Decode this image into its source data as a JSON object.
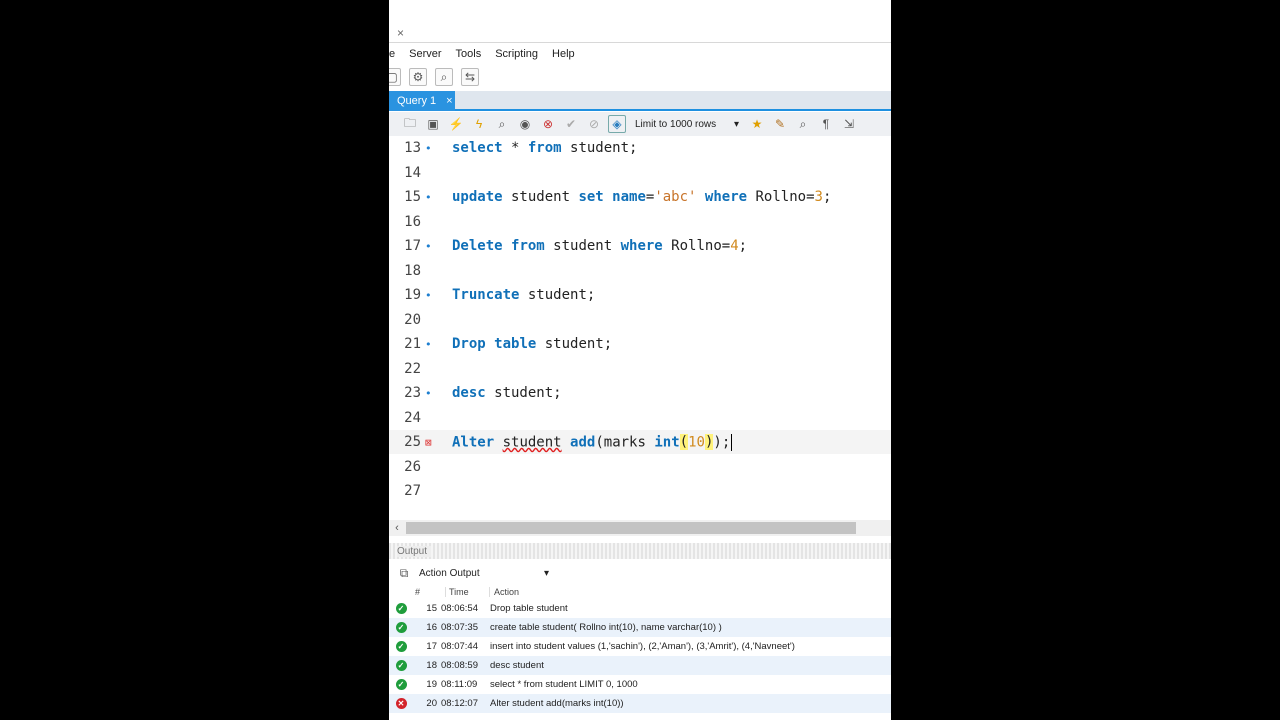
{
  "window": {
    "close_glyph": "×"
  },
  "menu": [
    "e",
    "Server",
    "Tools",
    "Scripting",
    "Help"
  ],
  "query_tab": {
    "label": "Query 1",
    "close": "×"
  },
  "toolbar": {
    "limit_label": "Limit to 1000 rows"
  },
  "editor": {
    "lines": [
      {
        "num": "13",
        "marker": "•"
      },
      {
        "num": "14",
        "marker": ""
      },
      {
        "num": "15",
        "marker": "•"
      },
      {
        "num": "16",
        "marker": ""
      },
      {
        "num": "17",
        "marker": "•"
      },
      {
        "num": "18",
        "marker": ""
      },
      {
        "num": "19",
        "marker": "•"
      },
      {
        "num": "20",
        "marker": ""
      },
      {
        "num": "21",
        "marker": "•"
      },
      {
        "num": "22",
        "marker": ""
      },
      {
        "num": "23",
        "marker": "•"
      },
      {
        "num": "24",
        "marker": ""
      },
      {
        "num": "25",
        "marker": "⊠"
      },
      {
        "num": "26",
        "marker": ""
      },
      {
        "num": "27",
        "marker": ""
      }
    ],
    "code": {
      "l13": [
        "select",
        " * ",
        "from",
        " student;"
      ],
      "l15": [
        "update",
        " student ",
        "set",
        " ",
        "name",
        "=",
        "'abc'",
        " ",
        "where",
        " Rollno=",
        "3",
        ";"
      ],
      "l17": [
        "Delete",
        " ",
        "from",
        " student ",
        "where",
        " Rollno=",
        "4",
        ";"
      ],
      "l19": [
        "Truncate",
        " student;"
      ],
      "l21": [
        "Drop",
        " ",
        "table",
        " student;"
      ],
      "l23": [
        "desc",
        " student;"
      ],
      "l25": [
        "Alter",
        " ",
        "student",
        " ",
        "add",
        "(marks ",
        "int",
        "(",
        "10",
        ")",
        ");"
      ]
    }
  },
  "output": {
    "title": "Output",
    "selector": "Action Output",
    "columns": [
      "#",
      "Time",
      "Action"
    ],
    "rows": [
      {
        "status": "ok",
        "num": "15",
        "time": "08:06:54",
        "action": "Drop table student"
      },
      {
        "status": "ok",
        "num": "16",
        "time": "08:07:35",
        "action": "create table student( Rollno int(10), name varchar(10) )"
      },
      {
        "status": "ok",
        "num": "17",
        "time": "08:07:44",
        "action": "insert into student values (1,'sachin'), (2,'Aman'), (3,'Amrit'), (4,'Navneet')"
      },
      {
        "status": "ok",
        "num": "18",
        "time": "08:08:59",
        "action": "desc student"
      },
      {
        "status": "ok",
        "num": "19",
        "time": "08:11:09",
        "action": "select * from student LIMIT 0, 1000"
      },
      {
        "status": "error",
        "num": "20",
        "time": "08:12:07",
        "action": "Alter student add(marks int(10))"
      }
    ]
  },
  "colors": {
    "keyword": "#1070b8",
    "string": "#c8742a",
    "number": "#d18a1e",
    "ok": "#1f9d3c",
    "error": "#d3242b",
    "accent": "#2a93e0"
  }
}
